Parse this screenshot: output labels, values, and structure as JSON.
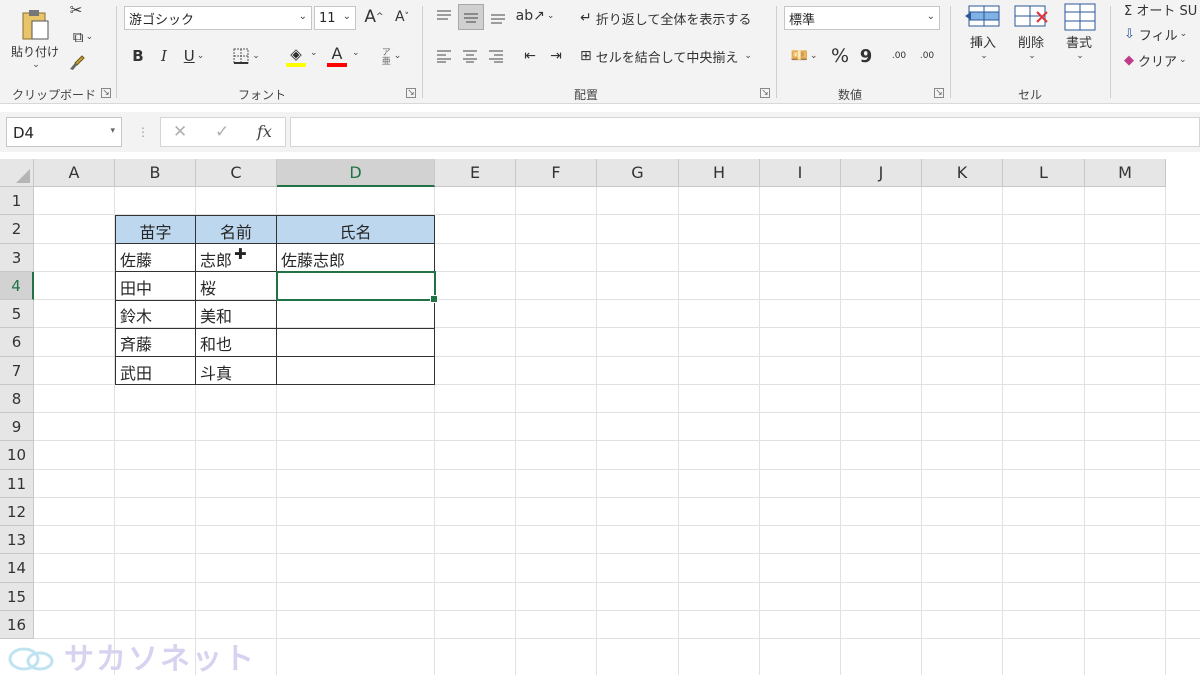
{
  "ribbon": {
    "clipboard": {
      "paste_label": "貼り付け",
      "group_label": "クリップボード"
    },
    "font": {
      "font_name": "游ゴシック",
      "font_size": "11",
      "grow_label": "A",
      "shrink_label": "A",
      "bold": "B",
      "italic": "I",
      "underline": "U",
      "phonetic_label": "ア亜",
      "group_label": "フォント",
      "fill_color": "#ffff00",
      "font_color": "#ff0000"
    },
    "alignment": {
      "wrap_text_label": "折り返して全体を表示する",
      "merge_label": "セルを結合して中央揃え",
      "group_label": "配置"
    },
    "number": {
      "format": "標準",
      "percent": "%",
      "comma": "9",
      "inc_decimal": ".00",
      "dec_decimal": ".00",
      "group_label": "数値"
    },
    "cells": {
      "insert": "挿入",
      "delete": "削除",
      "format": "書式",
      "group_label": "セル"
    },
    "editing": {
      "autosum": "Σ オート SU",
      "fill": "フィル",
      "clear": "クリア"
    }
  },
  "formula_bar": {
    "name_box": "D4",
    "formula": "",
    "fx": "fx"
  },
  "columns": [
    "A",
    "B",
    "C",
    "D",
    "E",
    "F",
    "G",
    "H",
    "I",
    "J",
    "K",
    "L",
    "M"
  ],
  "rows": [
    "1",
    "2",
    "3",
    "4",
    "5",
    "6",
    "7",
    "8",
    "9",
    "10",
    "11",
    "12",
    "13",
    "14",
    "15",
    "16"
  ],
  "selected_cell": "D4",
  "table": {
    "headers": [
      "苗字",
      "名前",
      "氏名"
    ],
    "rows": [
      [
        "佐藤",
        "志郎",
        "佐藤志郎"
      ],
      [
        "田中",
        "桜",
        ""
      ],
      [
        "鈴木",
        "美和",
        ""
      ],
      [
        "斉藤",
        "和也",
        ""
      ],
      [
        "武田",
        "斗真",
        ""
      ]
    ]
  },
  "watermark": "サカソネット",
  "colors": {
    "accent": "#217346",
    "table_header": "#bdd7ee"
  }
}
